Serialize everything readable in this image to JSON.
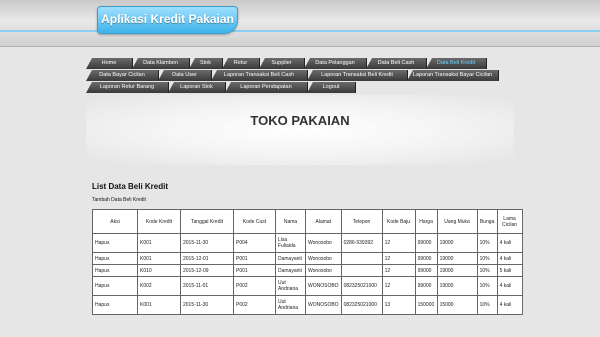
{
  "app_title": "Aplikasi Kredit Pakaian",
  "menu": {
    "row1": [
      {
        "label": "Home",
        "active": false
      },
      {
        "label": "Data Klamben",
        "active": false
      },
      {
        "label": "Stok",
        "active": false
      },
      {
        "label": "Retur",
        "active": false
      },
      {
        "label": "Supplier",
        "active": false
      },
      {
        "label": "Data Pelanggan",
        "active": false
      },
      {
        "label": "Data Beli Cash",
        "active": false
      },
      {
        "label": "Data Beli Kredit",
        "active": true
      }
    ],
    "row2": [
      {
        "label": "Data Bayar Cicilan"
      },
      {
        "label": "Data User"
      },
      {
        "label": "Laporan Transaksi Beli Cash"
      },
      {
        "label": "Laporan Transaksi Beli Kredit"
      },
      {
        "label": "Laporan Transaksi Bayar Cicilan"
      }
    ],
    "row3": [
      {
        "label": "Laporan Retur Barang"
      },
      {
        "label": "Laporan Stok"
      },
      {
        "label": "Laporan Pendapatan"
      },
      {
        "label": "Logout"
      }
    ]
  },
  "banner": "TOKO PAKAIAN",
  "list_title": "List Data Beli Kredit",
  "add_link": "Tambah Data Beli Kredit",
  "table": {
    "headers": [
      "Aksi",
      "Kode Kredit",
      "Tanggal Kredit",
      "Kode Cust",
      "Nama",
      "Alamat",
      "Telepon",
      "Kode Baju",
      "Harga",
      "Uang Muka",
      "Bunga",
      "Lama Cicilan"
    ],
    "rows": [
      [
        "Hapus",
        "K001",
        "2015-11-30",
        "P004",
        "Lisa Fuliaida",
        "Wonosobo",
        "0286-939392",
        "12",
        "99000",
        "19000",
        "10%",
        "4 kali"
      ],
      [
        "Hapus",
        "K001",
        "2015-12-01",
        "P001",
        "Damayanti",
        "Wonosobo",
        "",
        "12",
        "99000",
        "19000",
        "10%",
        "4 kali"
      ],
      [
        "Hapus",
        "K010",
        "2015-12-09",
        "P001",
        "Damayanti",
        "Wonosobo",
        "",
        "12",
        "99000",
        "19000",
        "10%",
        "5 kali"
      ],
      [
        "Hapus",
        "K002",
        "2015-11-01",
        "P002",
        "Uut Andriana",
        "WONOSOBO",
        "082325021000",
        "12",
        "99000",
        "19000",
        "10%",
        "4 kali"
      ],
      [
        "Hapus",
        "K001",
        "2015-11-30",
        "P002",
        "Uut Andriana",
        "WONOSOBO",
        "082325021000",
        "13",
        "150000",
        "15000",
        "10%",
        "4 kali"
      ]
    ]
  }
}
